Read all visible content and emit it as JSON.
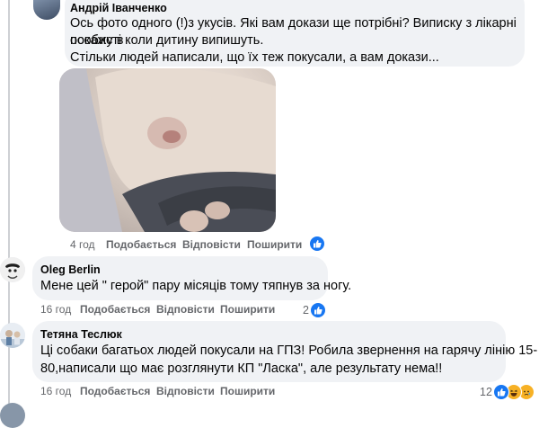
{
  "comments": [
    {
      "author": "Андрій Іванченко",
      "lines": [
        "Ось фото одного (!)з укусів. Які вам докази ще потрібні? Виписку з лікарні покажу в",
        "особисті коли дитину випишуть.",
        "Стільки людей написали, що їх теж покусали, а вам докази..."
      ],
      "time": "4 год",
      "like_label": "Подобається",
      "reply_label": "Відповісти",
      "share_label": "Поширити",
      "reaction_icons": [
        "like-icon"
      ]
    },
    {
      "author": "Oleg Berlin",
      "lines": [
        "Мене цей \" герой\" пару місяців тому тяпнув за ногу."
      ],
      "time": "16 год",
      "like_label": "Подобається",
      "reply_label": "Відповісти",
      "share_label": "Поширити",
      "reaction_count": "2",
      "reaction_icons": [
        "like-icon"
      ]
    },
    {
      "author": "Тетяна Теслюк",
      "lines": [
        "Ці собаки багатьох людей покусали на ГПЗ! Робила звернення на гарячу лінію 15-",
        "80,написали що має розглянути КП \"Ласка\", але результату нема!!"
      ],
      "time": "16 год",
      "like_label": "Подобається",
      "reply_label": "Відповісти",
      "share_label": "Поширити",
      "reaction_count": "12",
      "reaction_icons": [
        "like-icon",
        "haha-icon",
        "sad-icon"
      ]
    }
  ],
  "colors": {
    "bubble": "#f0f2f5",
    "meta_text": "#65676b",
    "like_blue": "#1877f2",
    "emoji_yellow": "#f7b125"
  }
}
